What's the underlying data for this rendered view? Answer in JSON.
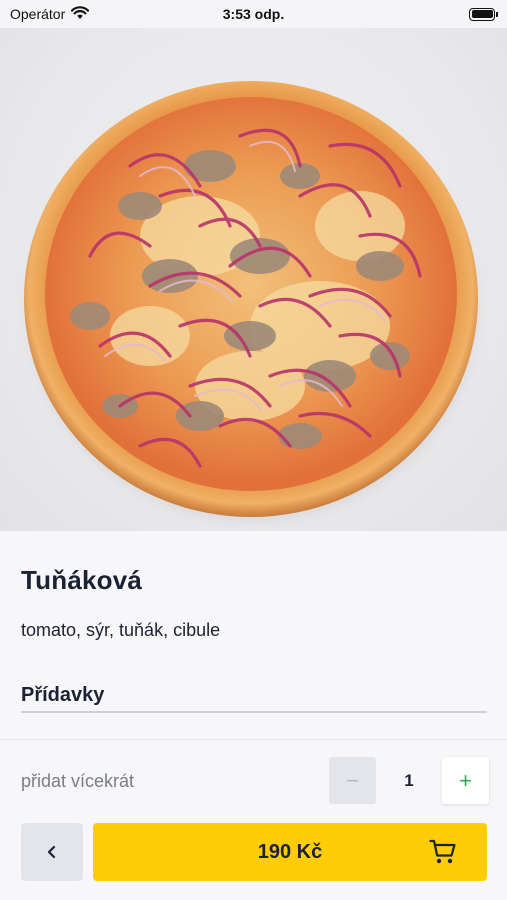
{
  "status_bar": {
    "carrier": "Operátor",
    "time": "3:53 odp.",
    "icons": [
      "wifi-icon",
      "battery-icon"
    ]
  },
  "hero": {
    "image": "pizza-photo"
  },
  "product": {
    "name": "Tuňáková",
    "ingredients": "tomato, sýr, tuňák, cibule",
    "extras_label": "Přídavky"
  },
  "order": {
    "repeat_label": "přidat vícekrát",
    "minus_symbol": "−",
    "quantity": "1",
    "plus_symbol": "+",
    "price": "190 Kč"
  },
  "colors": {
    "accent": "#ffcc08",
    "text_dark": "#1b2233",
    "plus_green": "#2eaa4f",
    "muted_gray": "#e3e5ea"
  }
}
